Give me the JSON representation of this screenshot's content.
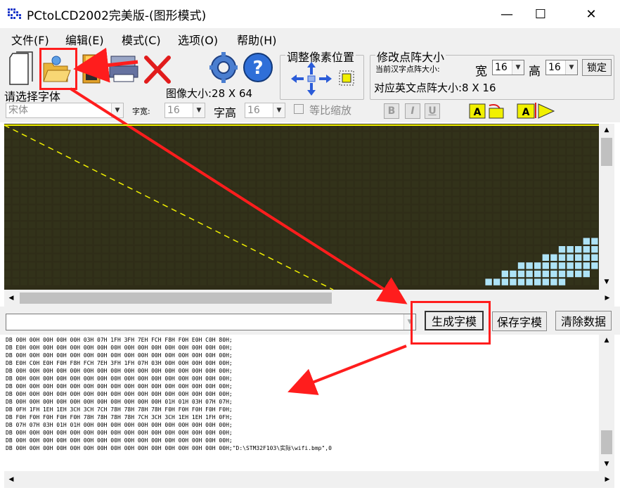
{
  "window": {
    "title": "PCtoLCD2002完美版-(图形模式)",
    "controls": {
      "minimize": "—",
      "maximize": "☐",
      "close": "✕"
    }
  },
  "menu": [
    {
      "label": "文件(F)"
    },
    {
      "label": "编辑(E)"
    },
    {
      "label": "模式(C)"
    },
    {
      "label": "选项(O)"
    },
    {
      "label": "帮助(H)"
    }
  ],
  "toolbar": {
    "icons": [
      "new-file-icon",
      "open-folder-icon",
      "save-icon",
      "printer-icon",
      "delete-x-icon",
      "settings-gear-icon",
      "help-icon"
    ],
    "adjust_pixel_group": "调整像素位置",
    "matrix_size_group": "修改点阵大小",
    "current_cn_size_label": "当前汉字点阵大小:",
    "width_label": "宽",
    "width_value": "16",
    "height_label": "高",
    "height_value": "16",
    "lock_button": "锁定",
    "en_size_text": "对应英文点阵大小:8 X 16",
    "font_select_label": "请选择字体",
    "font_value": "宋体",
    "image_size_text": "图像大小:28 X 64",
    "char_width_label": "字宽:",
    "char_width_value": "16",
    "char_height_label": "字高",
    "char_height_value": "16",
    "proportional_label": "等比缩放",
    "bold_label": "B",
    "italic_label": "I",
    "underline_label": "U"
  },
  "actions": {
    "input_value": "",
    "generate_button": "生成字模",
    "save_button": "保存字模",
    "clear_button": "清除数据"
  },
  "output": {
    "lines": [
      "DB 00H 00H 00H 00H 00H 03H 07H 1FH 3FH 7EH FCH F8H F0H E0H C0H 80H;",
      "DB E0H 00H 00H 00H 00H 00H 00H 00H 00H 00H 00H 00H 00H 00H 00H 00H;",
      "DB 00H 00H 00H 00H 00H 00H 00H 00H 00H 00H 00H 00H 00H 00H 00H 00H;",
      "DB E0H C0H E0H F0H F8H FCH 7EH 3FH 1FH 07H 03H 00H 00H 00H 00H 00H;",
      "DB 00H 00H 00H 00H 00H 00H 00H 00H 00H 00H 00H 00H 00H 00H 00H 00H;",
      "DB 00H 00H 00H 00H 00H 00H 00H 00H 00H 00H 00H 00H 00H 00H 00H 00H;",
      "DB 00H 00H 00H 00H 00H 00H 00H 00H 00H 00H 00H 00H 00H 00H 00H 00H;",
      "DB 00H 00H 00H 00H 00H 00H 00H 00H 00H 00H 00H 00H 00H 00H 00H 00H;",
      "DB 00H 00H 00H 00H 00H 00H 00H 00H 00H 00H 00H 01H 01H 03H 07H 07H;",
      "DB 0FH 1FH 1EH 1EH 3CH 3CH 7CH 78H 78H 78H 78H F0H F0H F0H F0H F0H;",
      "DB F0H F0H F0H F0H F0H 78H 78H 78H 78H 7CH 3CH 3CH 1EH 1EH 1FH 0FH;",
      "DB 07H 07H 03H 01H 01H 00H 00H 00H 00H 00H 00H 00H 00H 00H 00H 00H;",
      "DB 00H 00H 00H 00H 00H 00H 00H 00H 00H 00H 00H 00H 00H 00H 00H 00H;",
      "DB 00H 00H 00H 00H 00H 00H 00H 00H 00H 00H 00H 00H 00H 00H 00H 00H;",
      "DB 00H 00H 00H 00H 00H 00H 00H 00H 00H 00H 00H 00H 00H 00H 00H 00H;\"D:\\STM32F103\\实际\\wifi.bmp\",0"
    ]
  },
  "colors": {
    "canvas_bg": "#2f2d18",
    "pixel_off": "#32321a",
    "pixel_on": "#aee3f7",
    "grid": "#141408",
    "highlight": "#ff1d1d",
    "accent_yellow": "#f1f000"
  }
}
